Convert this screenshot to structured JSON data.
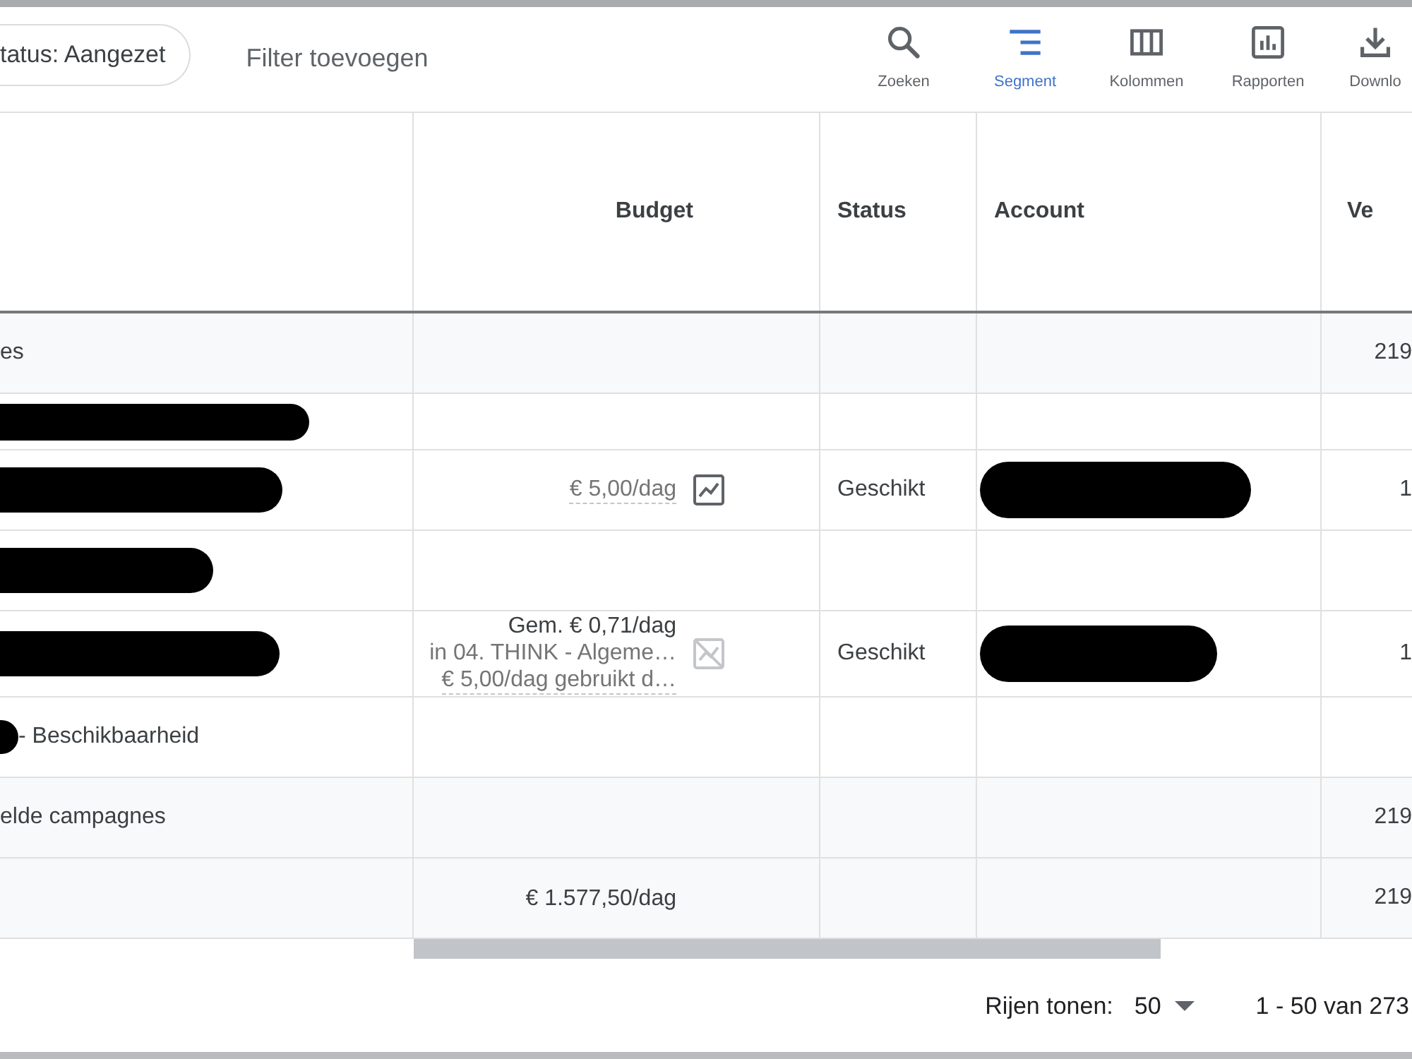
{
  "toolbar": {
    "filter_chip": {
      "label": "tatus: Aangezet"
    },
    "add_filter": {
      "label": "Filter toevoegen"
    },
    "buttons": [
      {
        "kind": "search",
        "label": "Zoeken",
        "selected": false
      },
      {
        "kind": "segment",
        "label": "Segment",
        "selected": true
      },
      {
        "kind": "columns",
        "label": "Kolommen",
        "selected": false
      },
      {
        "kind": "reports",
        "label": "Rapporten",
        "selected": false
      },
      {
        "kind": "download",
        "label": "Downlo",
        "selected": false
      }
    ]
  },
  "table": {
    "columns": [
      {
        "label": "Budget"
      },
      {
        "label": "Status"
      },
      {
        "label": "Account"
      },
      {
        "label": "Ve"
      }
    ],
    "rows": [
      {
        "kind": "total",
        "name": "es",
        "name_redacted": false,
        "account_redacted": false,
        "column_5": "219"
      },
      {
        "kind": "group",
        "name_redacted": true,
        "account_redacted": false
      },
      {
        "kind": "campaign",
        "name_redacted": true,
        "budget": {
          "lines": [
            {
              "text": "€ 5,00/dag",
              "muted": true,
              "underlined": true
            }
          ],
          "chart_available": true
        },
        "status": "Geschikt",
        "account_redacted": true,
        "column_5": "1"
      },
      {
        "kind": "group",
        "name_redacted": true,
        "account_redacted": false
      },
      {
        "kind": "campaign",
        "name_redacted": true,
        "budget": {
          "lines": [
            {
              "text": "Gem. € 0,71/dag",
              "muted": false,
              "underlined": false
            },
            {
              "text": "in 04. THINK - Algeme…",
              "muted": true,
              "underlined": false
            },
            {
              "text": "€ 5,00/dag gebruikt d…",
              "muted": true,
              "underlined": true
            }
          ],
          "chart_available": false
        },
        "status": "Geschikt",
        "account_redacted": true,
        "column_5": "1"
      },
      {
        "kind": "label",
        "name": "- Beschikbaarheid",
        "name_redacted": true,
        "account_redacted": false
      },
      {
        "kind": "total",
        "name": "elde campagnes",
        "name_redacted": false,
        "account_redacted": false,
        "column_5": "219"
      },
      {
        "kind": "total",
        "name_redacted": false,
        "budget": {
          "lines": [
            {
              "text": "€ 1.577,50/dag",
              "muted": false,
              "underlined": false
            }
          ]
        },
        "account_redacted": false,
        "column_5": "219"
      }
    ]
  },
  "footer": {
    "rows_per_page_label": "Rijen tonen:",
    "rows_per_page": "50",
    "range": "1 - 50 van 273"
  }
}
